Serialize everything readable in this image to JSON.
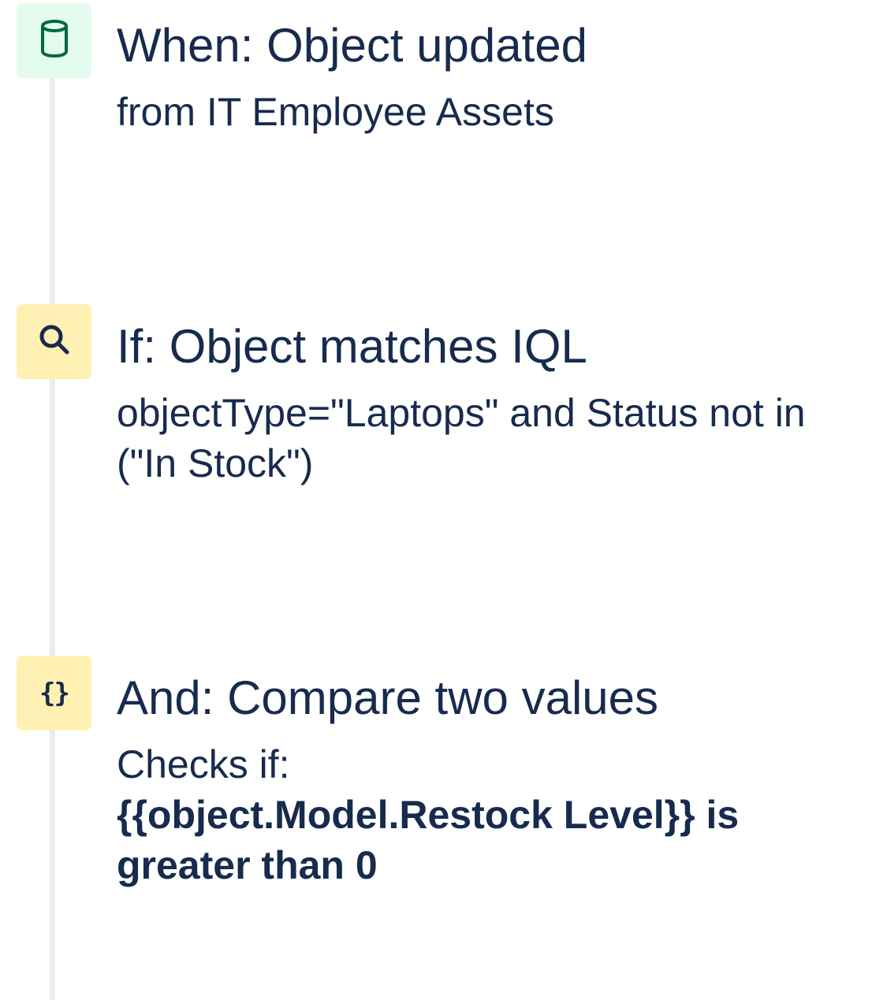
{
  "steps": [
    {
      "icon": "database-icon",
      "icon_color": "#e3fcef",
      "title": "When: Object updated",
      "subtitle": "from IT Employee Assets"
    },
    {
      "icon": "search-icon",
      "icon_color": "#fff0b3",
      "title": "If: Object matches IQL",
      "subtitle": "objectType=\"Laptops\" and Status not in (\"In Stock\")"
    },
    {
      "icon": "braces-icon",
      "icon_color": "#fff0b3",
      "icon_glyph": "{}",
      "title": "And: Compare two values",
      "subtitle": "Checks if:",
      "condition": "{{object.Model.Restock Level}} is greater than 0"
    }
  ],
  "colors": {
    "text": "#172b4d",
    "timeline": "#ebecf0"
  }
}
